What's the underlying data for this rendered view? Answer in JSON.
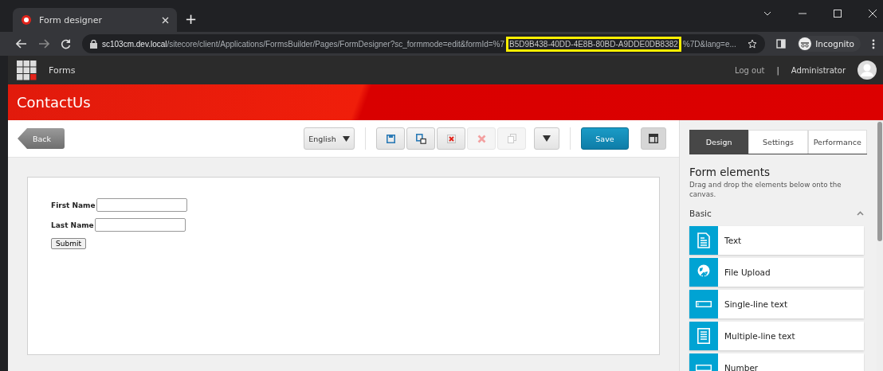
{
  "browser": {
    "tab_title": "Form designer",
    "new_tab": "+",
    "url_host": "sc103cm.dev.local",
    "url_path": "/sitecore/client/Applications/FormsBuilder/Pages/FormDesigner?sc_formmode=edit&formId=%7",
    "url_highlight": "B5D9B438-40DD-4E8B-80BD-A9DDE0DB8382",
    "url_rest": "%7D&lang=e...",
    "profile": "Incognito"
  },
  "app_bar": {
    "app_name": "Forms",
    "logout": "Log out",
    "separator": "|",
    "user": "Administrator"
  },
  "banner": {
    "title": "ContactUs"
  },
  "toolbar": {
    "back": "Back",
    "language": "English",
    "save": "Save",
    "tools": [
      {
        "kind": "save",
        "disabled": false
      },
      {
        "kind": "save-as",
        "disabled": false
      },
      {
        "kind": "delete",
        "disabled": false
      },
      {
        "kind": "remove",
        "disabled": true
      },
      {
        "kind": "copy",
        "disabled": true
      },
      {
        "kind": "more",
        "disabled": false
      }
    ]
  },
  "form": {
    "fields": [
      {
        "label": "First Name"
      },
      {
        "label": "Last Name"
      }
    ],
    "submit": "Submit"
  },
  "sidebar": {
    "tabs": [
      {
        "label": "Design",
        "selected": true
      },
      {
        "label": "Settings",
        "selected": false
      },
      {
        "label": "Performance",
        "selected": false
      }
    ],
    "heading": "Form elements",
    "hint": "Drag and drop the elements below onto the canvas.",
    "section": "Basic",
    "expanded": true,
    "elements": [
      {
        "kind": "text",
        "label": "Text"
      },
      {
        "kind": "upload",
        "label": "File Upload"
      },
      {
        "kind": "single",
        "label": "Single-line text"
      },
      {
        "kind": "multi",
        "label": "Multiple-line text"
      },
      {
        "kind": "number",
        "label": "Number"
      }
    ]
  }
}
